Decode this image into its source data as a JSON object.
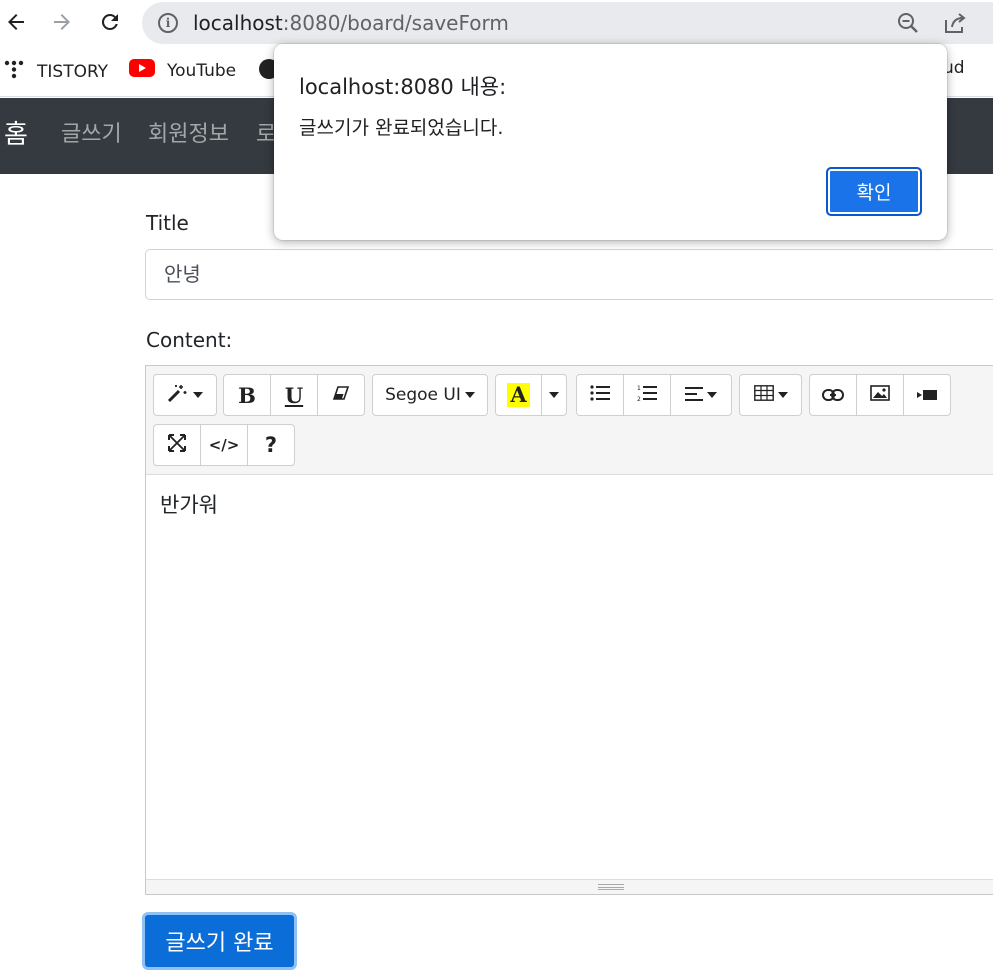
{
  "browser": {
    "url_host": "localhost",
    "url_rest": ":8080/board/saveForm"
  },
  "bookmarks": [
    {
      "label": "TISTORY"
    },
    {
      "label": "YouTube"
    },
    {
      "label": "ud"
    }
  ],
  "navbar": {
    "brand": "홈",
    "links": [
      "글쓰기",
      "회원정보",
      "로"
    ]
  },
  "form": {
    "title_label": "Title",
    "title_value": "안녕",
    "content_label": "Content:",
    "content_value": "반가워",
    "submit_label": "글쓰기 완료"
  },
  "editor": {
    "toolbar": {
      "bold": "B",
      "underline": "U",
      "font_name": "Segoe UI",
      "color_letter": "A",
      "help": "?"
    },
    "highlight_color": "#ffff00"
  },
  "dialog": {
    "title": "localhost:8080 내용:",
    "message": "글쓰기가 완료되었습니다.",
    "ok_label": "확인"
  },
  "colors": {
    "navbar_bg": "#343a40",
    "primary": "#0b6ed8",
    "dialog_ok": "#1a73e8"
  }
}
